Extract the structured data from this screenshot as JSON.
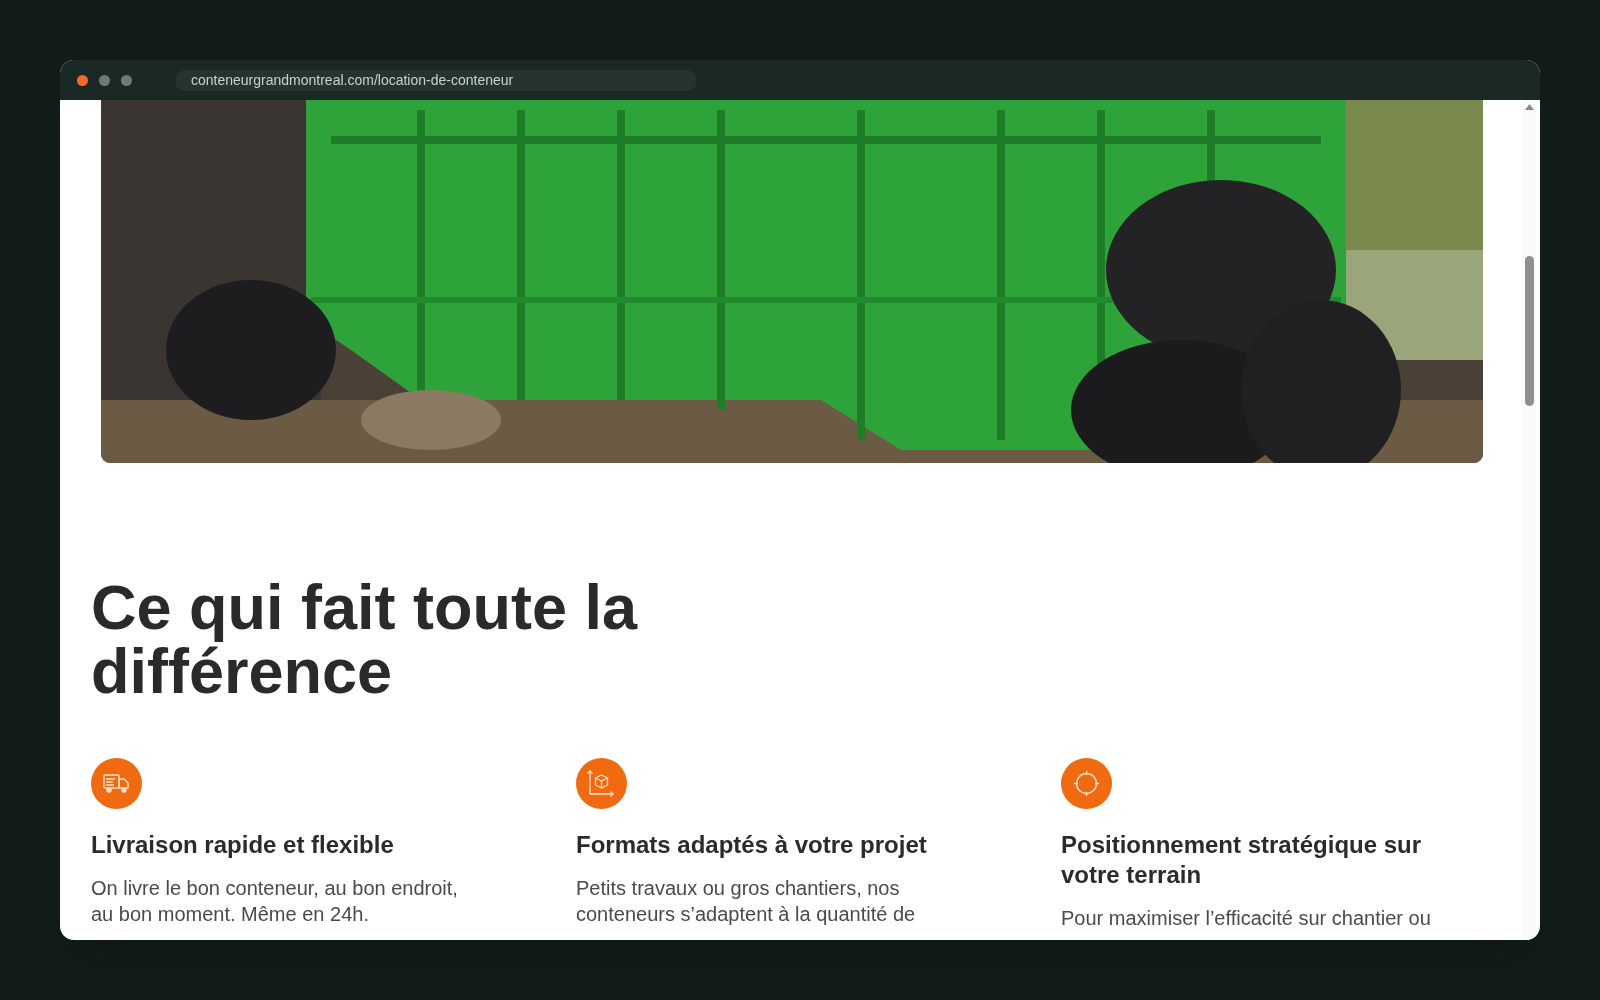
{
  "browser": {
    "dots": [
      {
        "color": "#f26b2a"
      },
      {
        "color": "#6e7a76"
      },
      {
        "color": "#6e7a76"
      }
    ],
    "url": "conteneurgrandmontreal.com/location-de-conteneur"
  },
  "section": {
    "heading": "Ce qui fait toute la différence",
    "features": [
      {
        "kind": "truck",
        "title": "Livraison rapide et flexible",
        "description": "On livre le bon conteneur, au bon endroit, au bon moment. Même en 24h."
      },
      {
        "kind": "dimensions",
        "title": "Formats adaptés à votre projet",
        "description": "Petits travaux ou gros chantiers, nos conteneurs s’adaptent à la quantité de"
      },
      {
        "kind": "target",
        "title": "Positionnement stratégique sur votre terrain",
        "description": "Pour maximiser l’efficacité sur chantier ou"
      }
    ]
  }
}
